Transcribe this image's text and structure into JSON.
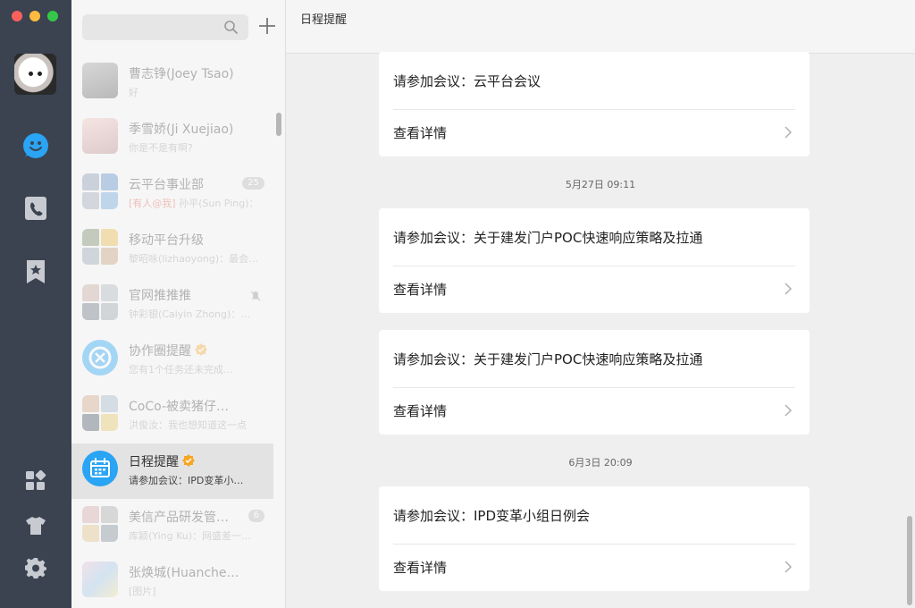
{
  "window": {
    "title": "日程提醒"
  },
  "search": {
    "placeholder": ""
  },
  "conversations": [
    {
      "name": "曹志铮(Joey Tsao)",
      "preview": "好",
      "faded": true
    },
    {
      "name": "季雪娇(Ji Xuejiao)",
      "preview": "你是不是有啊?",
      "faded": true
    },
    {
      "name": "云平台事业部",
      "preview_tag": "[有人@我]",
      "preview": "孙平(Sun Ping)：",
      "badge": "25",
      "faded": true
    },
    {
      "name": "移动平台升级",
      "preview": "黎昭咏(lizhaoyong)：最会…",
      "faded": true
    },
    {
      "name": "官网推推推",
      "preview": "钟彩银(Caiyin Zhong)：…",
      "faded": true
    },
    {
      "name": "协作圈提醒",
      "preview": "您有1个任务还未完成…",
      "faded": true
    },
    {
      "name": "CoCo-被卖猪仔…",
      "preview": "洪俊汝：我也想知道这一点",
      "faded": true
    },
    {
      "name": "日程提醒",
      "preview": "请参加会议：IPD变革小…",
      "faded": false
    },
    {
      "name": "美信产品研发管…",
      "preview": "库颖(Ying Ku)：网盛差一…",
      "badge": "6",
      "faded": true
    },
    {
      "name": "张焕城(Huanche…",
      "preview": "[图片]",
      "faded": true
    }
  ],
  "messages": [
    {
      "text": "请参加会议：云平台会议",
      "detail": "查看详情"
    },
    {
      "timestamp": "5月27日 09:11"
    },
    {
      "text": "请参加会议：关于建发门户POC快速响应策略及拉通",
      "detail": "查看详情"
    },
    {
      "text": "请参加会议：关于建发门户POC快速响应策略及拉通",
      "detail": "查看详情"
    },
    {
      "timestamp": "6月3日 20:09"
    },
    {
      "text": "请参加会议：IPD变革小组日例会",
      "detail": "查看详情"
    }
  ],
  "colors": {
    "rail_bg": "#3b4350",
    "accent_blue": "#2aa4f4",
    "verified_orange": "#f5a623",
    "mention_red": "#e0584b"
  },
  "icons": {
    "rail": [
      "chat-bubble-icon",
      "phone-book-icon",
      "star-bookmark-icon",
      "apps-grid-icon",
      "shirt-icon",
      "gear-icon"
    ],
    "search": "search-icon",
    "add": "plus-icon",
    "card": "chevron-right-icon",
    "verified": "verified-badge-icon",
    "calendar": "calendar-icon"
  }
}
